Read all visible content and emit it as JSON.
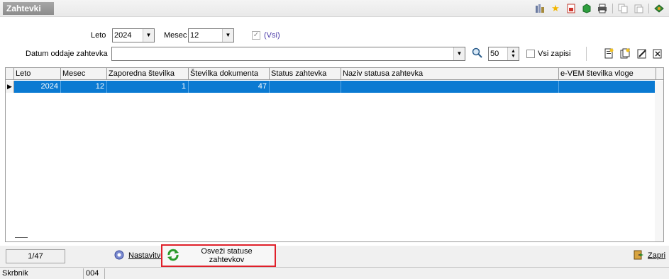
{
  "window": {
    "title": "Zahtevki"
  },
  "toolbar": {
    "icons": [
      "report-icon",
      "star-icon",
      "pdf-icon",
      "cube-icon",
      "print-icon",
      "copy-icon",
      "paste-icon",
      "exit-icon"
    ]
  },
  "filters": {
    "leto_label": "Leto",
    "leto_value": "2024",
    "mesec_label": "Mesec",
    "mesec_value": "12",
    "vsi_label": "(Vsi)",
    "datum_label": "Datum oddaje zahtevka",
    "datum_value": "",
    "count_value": "50",
    "vsi_zapisi_label": "Vsi zapisi"
  },
  "grid": {
    "columns": [
      "Leto",
      "Mesec",
      "Zaporedna številka",
      "Številka dokumenta",
      "Status zahtevka",
      "Naziv statusa zahtevka",
      "e-VEM številka vloge"
    ],
    "rows": [
      {
        "leto": "2024",
        "mesec": "12",
        "zaporedna": "1",
        "stevilka": "47",
        "status": "",
        "naziv": "",
        "evem": ""
      }
    ]
  },
  "footer": {
    "counter": "1/47",
    "nastavitve_label": "Nastavitve",
    "osvezi_label": "Osveži statuse zahtevkov",
    "zapri_label": "Zapri"
  },
  "statusbar": {
    "user": "Skrbnik",
    "code": "004"
  },
  "colors": {
    "selection": "#0a7ad2",
    "highlight_border": "#e0202a"
  }
}
